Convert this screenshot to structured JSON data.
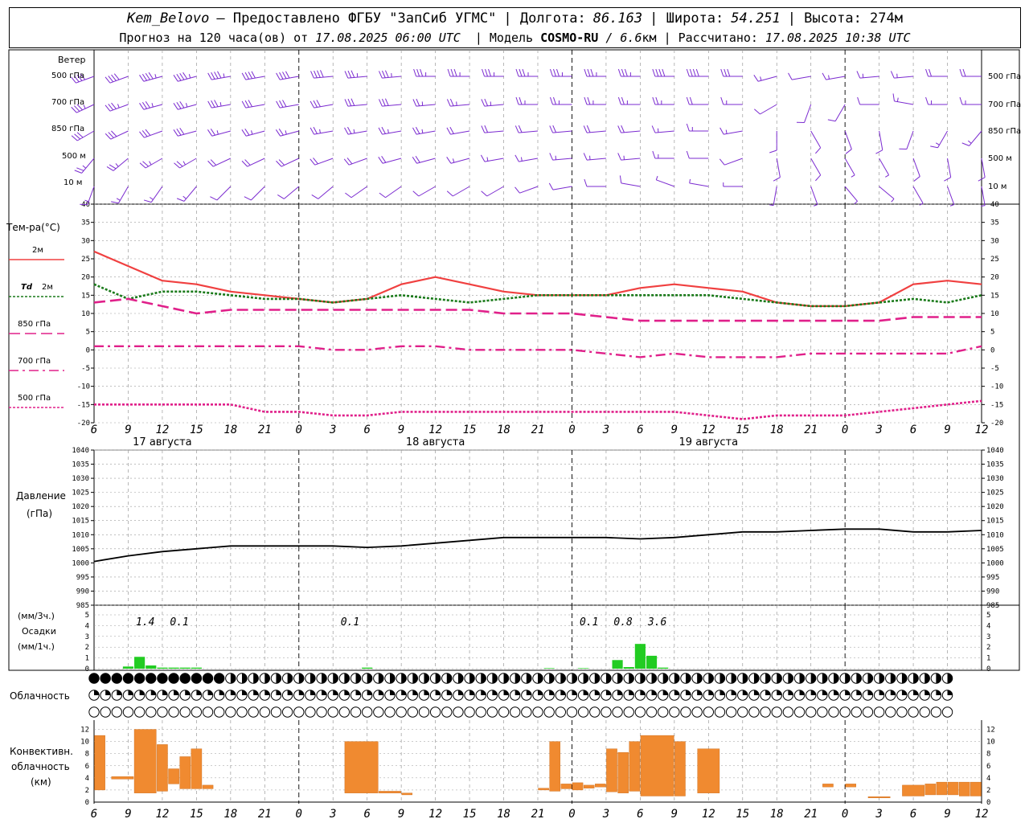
{
  "header": {
    "station": "Kem_Belovo",
    "provider": "– Предоставлено ФГБУ \"ЗапСиб УГМС\"",
    "lon_label": "| Долгота:",
    "lon": "86.163",
    "lat_label": "| Широта:",
    "lat": "54.251",
    "alt_label": "| Высота: 274м",
    "forecast_prefix": "Прогноз на 120 часа(ов) от",
    "forecast_from": "17.08.2025 06:00 UTC",
    "model_prefix": "| Модель",
    "model": "COSMO-RU",
    "model_res": "/ 6.6",
    "model_unit": "км",
    "computed_prefix": "| Рассчитано:",
    "computed": "17.08.2025 10:38 UTC"
  },
  "labels": {
    "wind": "Ветер",
    "wind_levels": [
      "500 гПа",
      "700 гПа",
      "850 гПа",
      "500 м",
      "10  м"
    ],
    "temp": "Тем-ра(°С)",
    "t2m": "2м",
    "td": "Td",
    "td2": "2м",
    "t850": "850 гПа",
    "t700": "700 гПа",
    "t500": "500 гПа",
    "pressure": "Давление",
    "pressure_unit": "(гПа)",
    "precip_unit3": "(мм/3ч.)",
    "precip": "Осадки",
    "precip_unit1": "(мм/1ч.)",
    "cloud": "Облачность",
    "conv1": "Конвективн.",
    "conv2": "облачность",
    "conv3": "(км)"
  },
  "colors": {
    "wind": "#7b2bd0",
    "t2m": "#f04040",
    "td": "#1a7a1a",
    "temp_levels": "#e0208a",
    "pressure": "#000000",
    "precip": "#22cc22",
    "conv": "#f08a30"
  },
  "chart_data": [
    {
      "type": "line",
      "panel": "temperature",
      "x_hours": [
        0,
        3,
        6,
        9,
        12,
        15,
        18,
        21,
        24,
        27,
        30,
        33,
        36,
        39,
        42,
        45,
        48,
        51,
        54,
        57,
        60,
        63,
        66,
        69,
        72,
        75,
        78
      ],
      "x_ticks": [
        "6",
        "9",
        "12",
        "15",
        "18",
        "21",
        "0",
        "3",
        "6",
        "9",
        "12",
        "15",
        "18",
        "21",
        "0",
        "3",
        "6",
        "9",
        "12",
        "15",
        "18",
        "21",
        "0",
        "3",
        "6",
        "9",
        "12"
      ],
      "x_days": [
        "17 августа",
        "18 августа",
        "19 августа"
      ],
      "ylim": [
        -20,
        40
      ],
      "y_ticks": [
        -20,
        -15,
        -10,
        -5,
        0,
        5,
        10,
        15,
        20,
        25,
        30,
        35,
        40
      ],
      "series": [
        {
          "name": "2м",
          "style": "solid",
          "values": [
            27,
            23,
            19,
            18,
            16,
            15,
            14,
            13,
            14,
            18,
            20,
            18,
            16,
            15,
            15,
            15,
            17,
            18,
            17,
            16,
            13,
            12,
            12,
            13,
            18,
            19,
            18
          ]
        },
        {
          "name": "Td 2м",
          "style": "dotted",
          "values": [
            18,
            14,
            16,
            16,
            15,
            14,
            14,
            13,
            14,
            15,
            14,
            13,
            14,
            15,
            15,
            15,
            15,
            15,
            15,
            14,
            13,
            12,
            12,
            13,
            14,
            13,
            15
          ]
        },
        {
          "name": "850 гПа",
          "style": "dashed",
          "values": [
            13,
            14,
            12,
            10,
            11,
            11,
            11,
            11,
            11,
            11,
            11,
            11,
            10,
            10,
            10,
            9,
            8,
            8,
            8,
            8,
            8,
            8,
            8,
            8,
            9,
            9,
            9
          ]
        },
        {
          "name": "700 гПа",
          "style": "dashdot",
          "values": [
            1,
            1,
            1,
            1,
            1,
            1,
            1,
            0,
            0,
            1,
            1,
            0,
            0,
            0,
            0,
            -1,
            -2,
            -1,
            -2,
            -2,
            -2,
            -1,
            -1,
            -1,
            -1,
            -1,
            1
          ]
        },
        {
          "name": "500 гПа",
          "style": "dotted",
          "values": [
            -15,
            -15,
            -15,
            -15,
            -15,
            -17,
            -17,
            -18,
            -18,
            -17,
            -17,
            -17,
            -17,
            -17,
            -17,
            -17,
            -17,
            -17,
            -18,
            -19,
            -18,
            -18,
            -18,
            -17,
            -16,
            -15,
            -14
          ]
        }
      ]
    },
    {
      "type": "line",
      "panel": "pressure",
      "x_hours": [
        0,
        3,
        6,
        9,
        12,
        15,
        18,
        21,
        24,
        27,
        30,
        33,
        36,
        39,
        42,
        45,
        48,
        51,
        54,
        57,
        60,
        63,
        66,
        69,
        72,
        75,
        78
      ],
      "ylim": [
        985,
        1040
      ],
      "y_ticks": [
        985,
        990,
        995,
        1000,
        1005,
        1010,
        1015,
        1020,
        1025,
        1030,
        1035,
        1040
      ],
      "values": [
        1000.5,
        1002.5,
        1004,
        1005,
        1006,
        1006,
        1006,
        1006,
        1005.5,
        1006,
        1007,
        1008,
        1009,
        1009,
        1009,
        1009,
        1008.5,
        1009,
        1010,
        1011,
        1011,
        1011.5,
        1012,
        1012,
        1011,
        1011,
        1011.5
      ]
    },
    {
      "type": "bar",
      "panel": "precipitation",
      "ylim": [
        0,
        5
      ],
      "y_ticks": [
        0,
        1,
        2,
        3,
        4,
        5
      ],
      "bars_hour": [
        3,
        4,
        5,
        6,
        7,
        8,
        9,
        24,
        40,
        43,
        46,
        47,
        48,
        49,
        50
      ],
      "values": [
        0.2,
        1.1,
        0.3,
        0.1,
        0.1,
        0.1,
        0.1,
        0.1,
        0.05,
        0.05,
        0.8,
        0.15,
        2.3,
        1.2,
        0.1
      ],
      "totals_3h": [
        {
          "hour": 4.5,
          "label": "1.4"
        },
        {
          "hour": 7.5,
          "label": "0.1"
        },
        {
          "hour": 22.5,
          "label": "0.1"
        },
        {
          "hour": 43.5,
          "label": "0.1"
        },
        {
          "hour": 46.5,
          "label": "0.8"
        },
        {
          "hour": 49.5,
          "label": "3.6"
        }
      ]
    },
    {
      "type": "table",
      "panel": "cloud_cover",
      "rows": [
        "bbbbbbbbbbbbhhhhhhhhhhhhhhhhhhhhhhhhhhhhhhhhhhhhhhhhhhhhhhhhhhhhhhhhhhhhhhhh",
        "qqqqqqqqqqqqqqqqqqqqqqqqqqqqqqqqqqqqqqqqqqqqqqqqqqqqqqqqqqqqqqqqqqqqqqqqqqqq",
        "eeeeeeeeeeeeeeeeeeeeeeeeeeeeeeeeeeeeeeeeeeeeeeeeeeeeeeeeeeeeeeeeeeeeeeeeeeee"
      ]
    },
    {
      "type": "bar",
      "panel": "convective_cloud",
      "ylim": [
        0,
        13
      ],
      "y_ticks": [
        0,
        2,
        4,
        6,
        8,
        10,
        12
      ],
      "bars": [
        {
          "h0": 0,
          "h1": 1,
          "b": 2,
          "t": 11
        },
        {
          "h0": 1.5,
          "h1": 3.5,
          "b": 3.8,
          "t": 4.2
        },
        {
          "h0": 3.5,
          "h1": 5.5,
          "b": 1.5,
          "t": 12
        },
        {
          "h0": 5.5,
          "h1": 6.5,
          "b": 1.8,
          "t": 9.5
        },
        {
          "h0": 6.5,
          "h1": 7.5,
          "b": 3,
          "t": 5.5
        },
        {
          "h0": 7.5,
          "h1": 8.5,
          "b": 2.2,
          "t": 7.5
        },
        {
          "h0": 8.5,
          "h1": 9.5,
          "b": 2.2,
          "t": 8.8
        },
        {
          "h0": 9.5,
          "h1": 10.5,
          "b": 2.2,
          "t": 2.8
        },
        {
          "h0": 22,
          "h1": 25,
          "b": 1.5,
          "t": 10
        },
        {
          "h0": 25,
          "h1": 27,
          "b": 1.5,
          "t": 1.8
        },
        {
          "h0": 27,
          "h1": 28,
          "b": 1.2,
          "t": 1.5
        },
        {
          "h0": 39,
          "h1": 40,
          "b": 2,
          "t": 2.3
        },
        {
          "h0": 40,
          "h1": 41,
          "b": 1.8,
          "t": 10
        },
        {
          "h0": 41,
          "h1": 42,
          "b": 2.2,
          "t": 3
        },
        {
          "h0": 42,
          "h1": 43,
          "b": 2,
          "t": 3.2
        },
        {
          "h0": 43,
          "h1": 44,
          "b": 2.3,
          "t": 2.8
        },
        {
          "h0": 44,
          "h1": 45,
          "b": 2.5,
          "t": 3
        },
        {
          "h0": 45,
          "h1": 46,
          "b": 1.7,
          "t": 8.8
        },
        {
          "h0": 46,
          "h1": 47,
          "b": 1.5,
          "t": 8.2
        },
        {
          "h0": 47,
          "h1": 48,
          "b": 1.8,
          "t": 10
        },
        {
          "h0": 48,
          "h1": 51,
          "b": 1,
          "t": 11
        },
        {
          "h0": 51,
          "h1": 52,
          "b": 1,
          "t": 10
        },
        {
          "h0": 53,
          "h1": 55,
          "b": 1.5,
          "t": 8.8
        },
        {
          "h0": 64,
          "h1": 65,
          "b": 2.5,
          "t": 3
        },
        {
          "h0": 66,
          "h1": 67,
          "b": 2.5,
          "t": 3
        },
        {
          "h0": 68,
          "h1": 70,
          "b": 0.7,
          "t": 0.9
        },
        {
          "h0": 71,
          "h1": 73,
          "b": 1,
          "t": 2.8
        },
        {
          "h0": 73,
          "h1": 74,
          "b": 1.2,
          "t": 3
        },
        {
          "h0": 74,
          "h1": 75,
          "b": 1.2,
          "t": 3.3
        },
        {
          "h0": 75,
          "h1": 76,
          "b": 1.2,
          "t": 3.3
        },
        {
          "h0": 76,
          "h1": 77,
          "b": 1,
          "t": 3.3
        },
        {
          "h0": 77,
          "h1": 78,
          "b": 1,
          "t": 3.3
        }
      ]
    },
    {
      "type": "scatter",
      "panel": "wind_barbs",
      "levels": [
        "500 гПа",
        "700 гПа",
        "850 гПа",
        "500 м",
        "10  м"
      ],
      "direction_deg": [
        [
          250,
          250,
          255,
          255,
          260,
          260,
          260,
          265,
          265,
          265,
          270,
          270,
          270,
          270,
          270,
          270,
          270,
          270,
          270,
          270,
          255,
          260,
          260,
          265,
          265,
          270,
          270
        ],
        [
          245,
          250,
          255,
          255,
          260,
          260,
          260,
          260,
          265,
          265,
          265,
          265,
          265,
          270,
          270,
          270,
          270,
          270,
          270,
          270,
          240,
          200,
          210,
          270,
          280,
          270,
          270
        ],
        [
          240,
          245,
          250,
          255,
          255,
          255,
          255,
          260,
          260,
          260,
          260,
          260,
          265,
          265,
          265,
          265,
          265,
          265,
          270,
          260,
          180,
          150,
          160,
          170,
          200,
          210,
          220
        ],
        [
          220,
          230,
          240,
          240,
          245,
          245,
          245,
          250,
          250,
          255,
          255,
          255,
          260,
          260,
          265,
          265,
          265,
          270,
          270,
          250,
          170,
          150,
          150,
          150,
          160,
          170,
          170
        ],
        [
          200,
          210,
          215,
          220,
          225,
          225,
          230,
          230,
          235,
          235,
          240,
          240,
          240,
          250,
          260,
          270,
          280,
          290,
          280,
          270,
          190,
          160,
          140,
          130,
          150,
          160,
          170
        ]
      ],
      "speed_kt": [
        [
          40,
          40,
          45,
          45,
          45,
          40,
          40,
          40,
          35,
          35,
          35,
          35,
          35,
          35,
          35,
          35,
          35,
          40,
          40,
          30,
          15,
          10,
          15,
          15,
          15,
          20,
          20
        ],
        [
          35,
          35,
          35,
          35,
          35,
          30,
          30,
          30,
          30,
          30,
          25,
          25,
          25,
          25,
          25,
          25,
          25,
          25,
          20,
          15,
          10,
          10,
          10,
          10,
          15,
          15,
          15
        ],
        [
          30,
          30,
          30,
          30,
          25,
          25,
          25,
          25,
          25,
          25,
          25,
          20,
          20,
          20,
          20,
          20,
          20,
          15,
          15,
          15,
          10,
          10,
          10,
          10,
          10,
          15,
          15
        ],
        [
          25,
          25,
          25,
          25,
          20,
          20,
          20,
          20,
          20,
          20,
          20,
          15,
          15,
          15,
          15,
          15,
          15,
          15,
          10,
          10,
          10,
          10,
          5,
          5,
          10,
          10,
          10
        ],
        [
          15,
          15,
          15,
          15,
          10,
          10,
          10,
          10,
          10,
          10,
          10,
          10,
          10,
          10,
          10,
          10,
          10,
          5,
          5,
          5,
          5,
          5,
          5,
          5,
          5,
          5,
          5
        ]
      ]
    }
  ]
}
